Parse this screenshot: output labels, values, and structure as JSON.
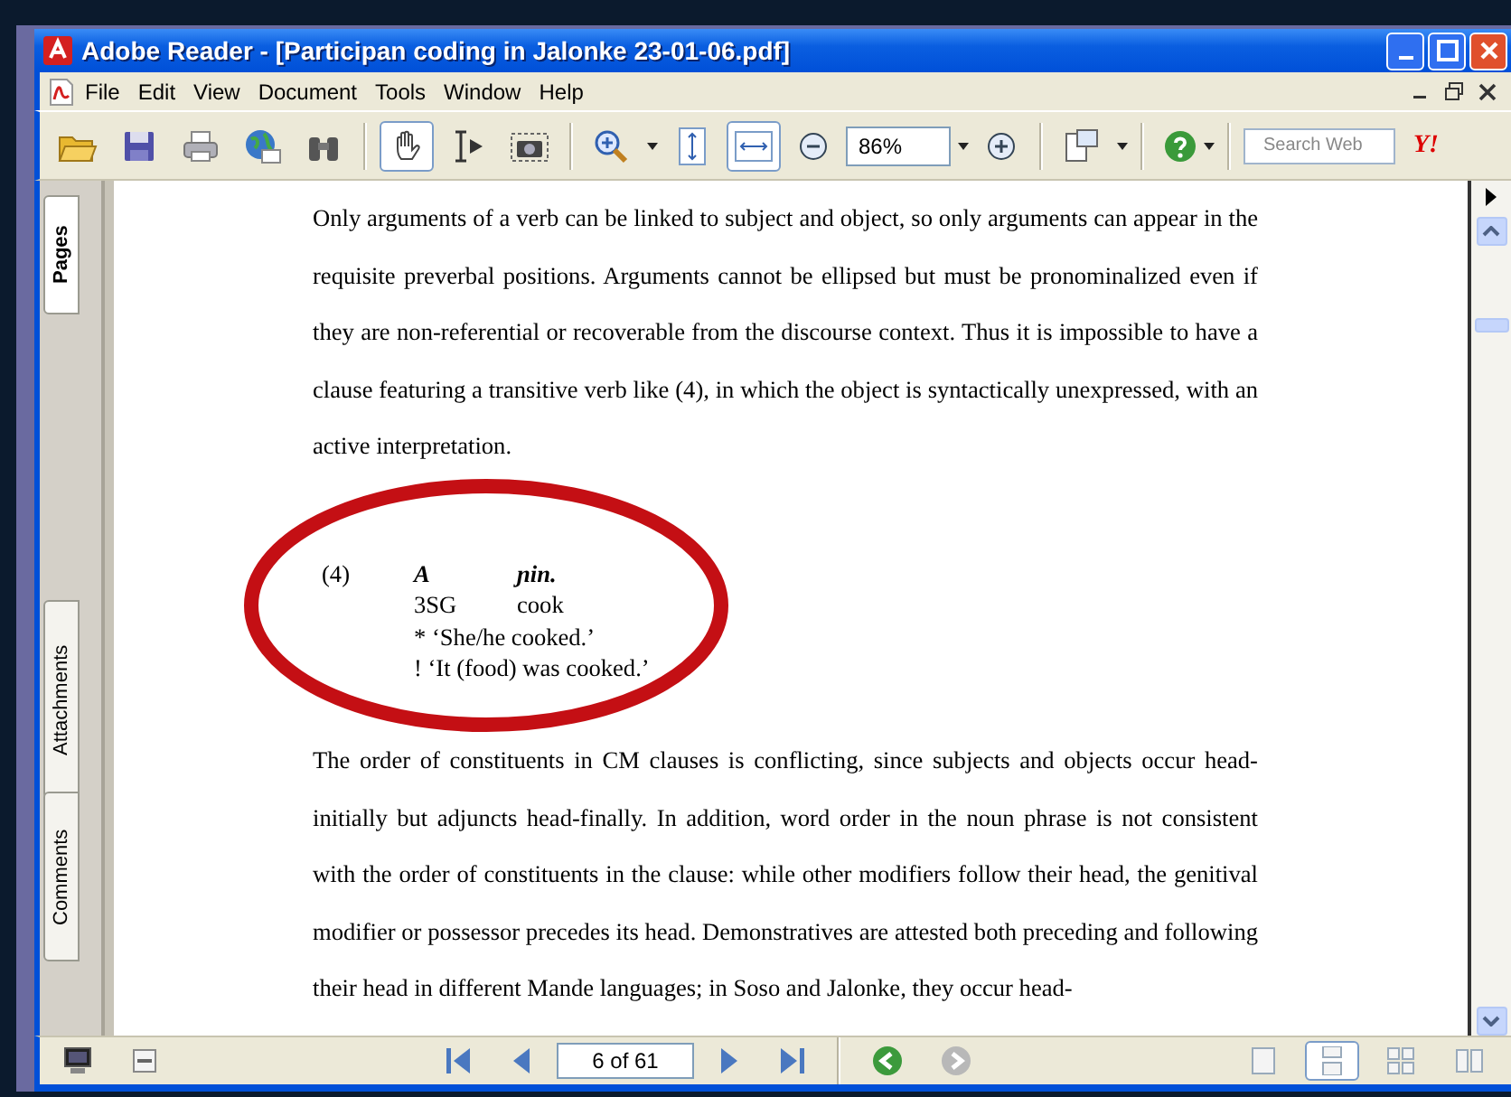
{
  "window": {
    "title": "Adobe Reader - [Participan coding in Jalonke 23-01-06.pdf]"
  },
  "menu": [
    "File",
    "Edit",
    "View",
    "Document",
    "Tools",
    "Window",
    "Help"
  ],
  "toolbar": {
    "tools": [
      {
        "selected": true
      },
      {
        "selected": false
      },
      {
        "selected": false
      }
    ],
    "fit": [
      {
        "selected": false
      },
      {
        "selected": true
      }
    ],
    "zoom": "86%",
    "search": {
      "placeholder": "Search Web"
    },
    "logo": "Y!"
  },
  "side_tabs": [
    {
      "label": "Pages",
      "selected": true
    },
    {
      "label": "Attachments",
      "selected": false
    },
    {
      "label": "Comments",
      "selected": false
    }
  ],
  "document": {
    "paragraph_1": "Only arguments of a verb can be linked to subject and object, so only arguments can appear in the requisite preverbal positions. Arguments cannot be ellipsed but must be pronominalized even if they are non-referential or recoverable from the discourse context. Thus it is impossible to have a clause featuring a transitive verb like (4), in which the object is syntactically unexpressed, with an active interpretation.",
    "example": {
      "number": "(4)",
      "words": [
        "A",
        "ɲin."
      ],
      "glosses": [
        "3SG",
        "cook"
      ],
      "translations": [
        "* ‘She/he cooked.’",
        "! ‘It (food) was cooked.’"
      ]
    },
    "paragraph_2": "The order of constituents in CM clauses is conflicting, since subjects and objects occur head-initially but adjuncts head-finally. In addition, word order in the noun phrase is not consistent with the order of constituents in the clause: while other modifiers follow their head, the genitival modifier or possessor precedes its head. Demonstratives are attested both preceding and following their head in different Mande languages; in Soso and Jalonke, they occur head-"
  },
  "status_bar": {
    "page": "6 of 61",
    "history": [
      {
        "disabled": false
      },
      {
        "disabled": true
      }
    ],
    "views": [
      {
        "selected": false
      },
      {
        "selected": true
      },
      {
        "selected": false
      },
      {
        "selected": false
      }
    ]
  }
}
